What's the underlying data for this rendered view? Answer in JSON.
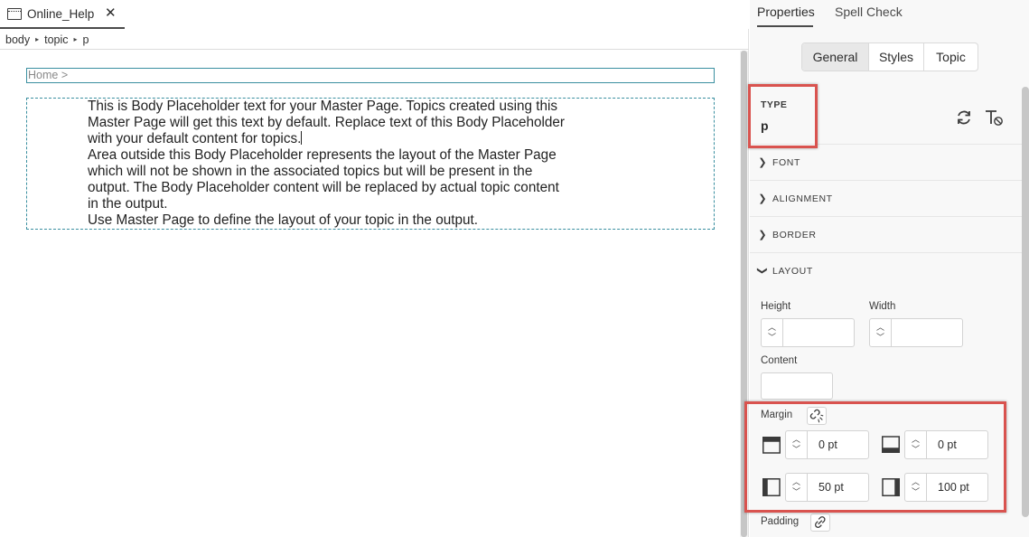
{
  "editor": {
    "tab": {
      "label": "Online_Help",
      "close": "✕",
      "icon": "document-window-icon"
    },
    "breadcrumb": [
      "body",
      "topic",
      "p"
    ],
    "breadcrumb_sep": "▸",
    "home_text": "Home >",
    "body_lines": [
      "This is Body Placeholder text for your Master Page. Topics created using this",
      "Master Page will get this text by default. Replace text of this Body Placeholder",
      "with your default content for topics.",
      "Area outside this Body Placeholder represents the layout of the Master Page",
      "which will not be shown in the associated topics but will be present in the",
      "output. The Body Placeholder content will be replaced by actual topic content",
      "in the output.",
      "Use Master Page to define the layout of your topic in the output."
    ]
  },
  "panel": {
    "tabs": [
      "Properties",
      "Spell Check"
    ],
    "segments": [
      "General",
      "Styles",
      "Topic"
    ],
    "type_label": "TYPE",
    "type_value": "p",
    "sections": [
      "FONT",
      "ALIGNMENT",
      "BORDER",
      "LAYOUT"
    ],
    "layout": {
      "height_label": "Height",
      "width_label": "Width",
      "content_label": "Content",
      "margin_label": "Margin",
      "margin_top": "0 pt",
      "margin_bottom": "0 pt",
      "margin_left": "50 pt",
      "margin_right": "100 pt",
      "padding_label": "Padding"
    }
  },
  "colors": {
    "highlight": "#d9534f",
    "placeholder_border": "#3a8fa0"
  }
}
